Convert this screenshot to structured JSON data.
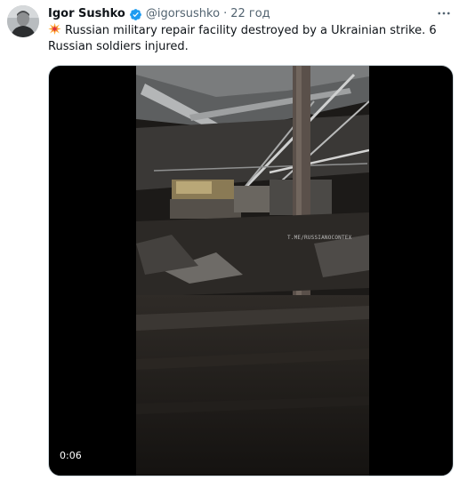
{
  "tweet": {
    "author_name": "Igor Sushko",
    "author_handle": "@igorsushko",
    "separator": "·",
    "time": "22 год",
    "text": "Russian military repair facility destroyed by a Ukrainian strike. 6 Russian soldiers injured.",
    "emoji_icon": "collision-emoji-icon",
    "verified_icon": "verified-badge-icon",
    "more_icon": "more-options-icon"
  },
  "video": {
    "watermark": "T.ME/RUSSIANOCONTEX",
    "duration": "0:06"
  },
  "colors": {
    "verified": "#1d9bf0",
    "secondary_text": "#536471",
    "primary_text": "#0f1419"
  }
}
